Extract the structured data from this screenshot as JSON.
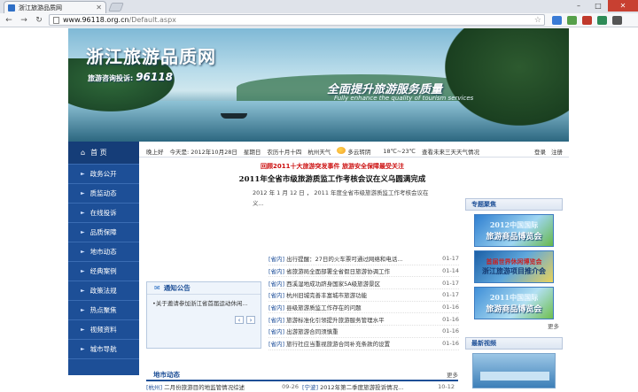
{
  "browser": {
    "tab_title": "浙江旅游品质网",
    "url_host": "www.96118.org.cn",
    "url_path": "/Default.aspx",
    "window_controls": [
      "–",
      "□",
      "✕"
    ]
  },
  "site": {
    "title": "浙江旅游品质网",
    "hotline_label": "旅游咨询投诉:",
    "hotline_number": "96118",
    "slogan": "全面提升旅游服务质量",
    "slogan_en": "Fully enhance the quality of tourism services"
  },
  "nav": {
    "home": "首  页",
    "items": [
      "政务公开",
      "质监动态",
      "在线投诉",
      "品质保障",
      "地市动态",
      "经典案例",
      "政策法规",
      "热点聚焦",
      "视频资料",
      "城市导航"
    ]
  },
  "infobar": {
    "greeting": "晚上好",
    "today": "今天是: 2012年10月28日",
    "weekday": "星期日",
    "lunar": "农历十月十四",
    "city": "杭州天气",
    "weather": "多云转阴",
    "temp": "18℃~23℃",
    "forecast": "查看未来三天天气情况",
    "login": "登录",
    "register": "注册"
  },
  "headlines": {
    "red": "回顾2011十大旅游突发事件  旅游安全保障最受关注",
    "main": "2011年全省市级旅游质监工作考核会议在义乌圆满完成",
    "summary_line1": "2012 年 1 月 12 日 ， 2011 年度全省市级旅游质监工作考核会议在",
    "summary_line2": "义..."
  },
  "news": [
    {
      "tag": "[省内]",
      "text": "出行提醒：27日的火车票可通过网络和电话...",
      "date": "01-17"
    },
    {
      "tag": "[省内]",
      "text": "省旅游局全面部署全省假日旅游协调工作",
      "date": "01-14"
    },
    {
      "tag": "[省内]",
      "text": "西溪湿地成功跻身国家5A级旅游景区",
      "date": "01-17"
    },
    {
      "tag": "[省内]",
      "text": "杭州旧城完善丰富城市旅游功能",
      "date": "01-17"
    },
    {
      "tag": "[省内]",
      "text": "县级旅游质监工作存在的问题",
      "date": "01-16"
    },
    {
      "tag": "[省内]",
      "text": "旅游标准化引领提升旅游服务管理水平",
      "date": "01-16"
    },
    {
      "tag": "[省内]",
      "text": "出游旅游合同须慎重",
      "date": "01-16"
    },
    {
      "tag": "[省内]",
      "text": "旅行社应当重视旅游合同补充条款的设置",
      "date": "01-16"
    }
  ],
  "notice": {
    "title": "通知公告",
    "item": "•关于邀请参加浙江省首届运动休闲...",
    "prev": "‹",
    "next": "›"
  },
  "local": {
    "title": "地市动态",
    "more": "更多",
    "rows": [
      [
        {
          "tag": "[杭州]",
          "text": "二月份旅游目的地监管情况综述",
          "date": "09-26"
        },
        {
          "tag": "[宁波]",
          "text": "2012年第二季度旅游投诉情况...",
          "date": "10-12"
        }
      ]
    ]
  },
  "right": {
    "focus_title": "专题聚焦",
    "promos": [
      {
        "year": "2012中国国际",
        "name": "旅游商品博览会"
      },
      {
        "year": "首届世界休闲博览会",
        "name": "浙江旅游项目推介会"
      },
      {
        "year": "2011中国国际",
        "name": "旅游商品博览会"
      }
    ],
    "more": "更多",
    "video_title": "最新视频"
  },
  "colors": {
    "nav_blue": "#1d4f97",
    "accent_red": "#cc1010",
    "tag_blue": "#1e4f9a"
  }
}
